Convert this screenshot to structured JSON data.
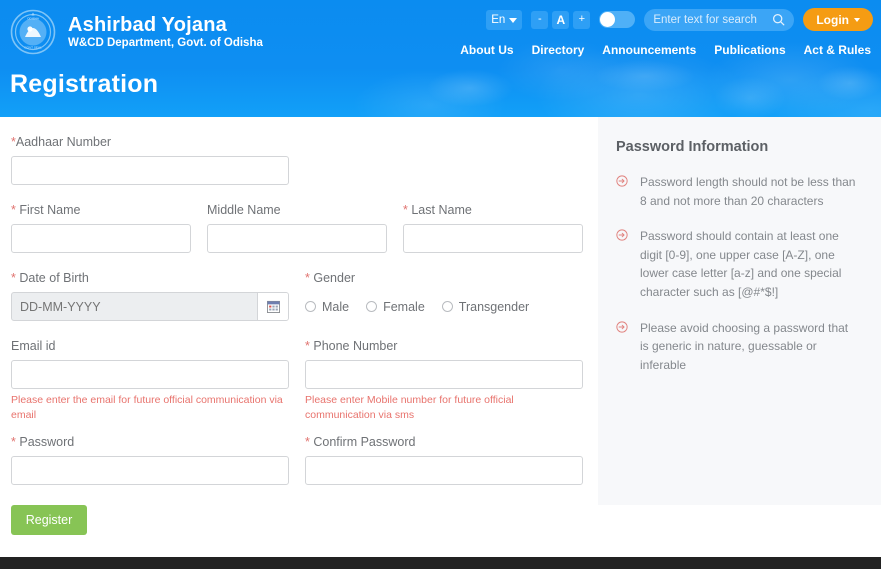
{
  "header": {
    "brand_title": "Ashirbad Yojana",
    "brand_subtitle": "W&CD Department, Govt. of Odisha",
    "emblem_icon": "odisha-government-emblem-icon",
    "page_title": "Registration",
    "language": "En",
    "font_decrease": "-",
    "font_letter": "A",
    "font_increase": "+",
    "contrast_toggle": "contrast-toggle",
    "search_placeholder": "Enter text for search",
    "search_icon": "search-icon",
    "login_label": "Login",
    "nav": [
      {
        "label": "About Us"
      },
      {
        "label": "Directory"
      },
      {
        "label": "Announcements"
      },
      {
        "label": "Publications"
      },
      {
        "label": "Act & Rules"
      }
    ]
  },
  "form": {
    "aadhaar": {
      "label": "Aadhaar Number",
      "required": true,
      "value": "",
      "placeholder": ""
    },
    "first_name": {
      "label": "First Name",
      "required": true,
      "value": "",
      "placeholder": ""
    },
    "middle_name": {
      "label": "Middle Name",
      "required": false,
      "value": "",
      "placeholder": ""
    },
    "last_name": {
      "label": "Last Name",
      "required": true,
      "value": "",
      "placeholder": ""
    },
    "dob": {
      "label": "Date of Birth",
      "required": true,
      "value": "",
      "placeholder": "DD-MM-YYYY",
      "icon": "calendar-icon"
    },
    "gender": {
      "label": "Gender",
      "required": true,
      "options": [
        {
          "label": "Male",
          "selected": false
        },
        {
          "label": "Female",
          "selected": false
        },
        {
          "label": "Transgender",
          "selected": false
        }
      ]
    },
    "email": {
      "label": "Email id",
      "required": false,
      "value": "",
      "placeholder": "",
      "helper": "Please enter the email for future official communication via email"
    },
    "phone": {
      "label": "Phone Number",
      "required": true,
      "value": "",
      "placeholder": "",
      "helper": "Please enter Mobile number for future official communication via sms"
    },
    "password": {
      "label": "Password",
      "required": true,
      "value": "",
      "placeholder": ""
    },
    "confirm_password": {
      "label": "Confirm Password",
      "required": true,
      "value": "",
      "placeholder": ""
    },
    "submit_label": "Register",
    "required_marker": "*"
  },
  "password_panel": {
    "title": "Password Information",
    "bullet_icon": "arrow-circle-icon",
    "items": [
      {
        "text": "Password length should not be less than 8 and not more than 20 characters"
      },
      {
        "text": "Password should contain at least one digit [0-9], one upper case [A-Z], one lower case letter [a-z] and one special character such as [@#*$!]"
      },
      {
        "text": "Please avoid choosing a password that is generic in nature, guessable or inferable"
      }
    ]
  },
  "colors": {
    "header_blue": "#0b8cf0",
    "login_orange": "#f59c13",
    "register_green": "#87c455",
    "helper_red": "#e8736d",
    "required_red": "#e0736f",
    "panel_bg": "#f7f8fa",
    "footer_dark": "#222222"
  }
}
